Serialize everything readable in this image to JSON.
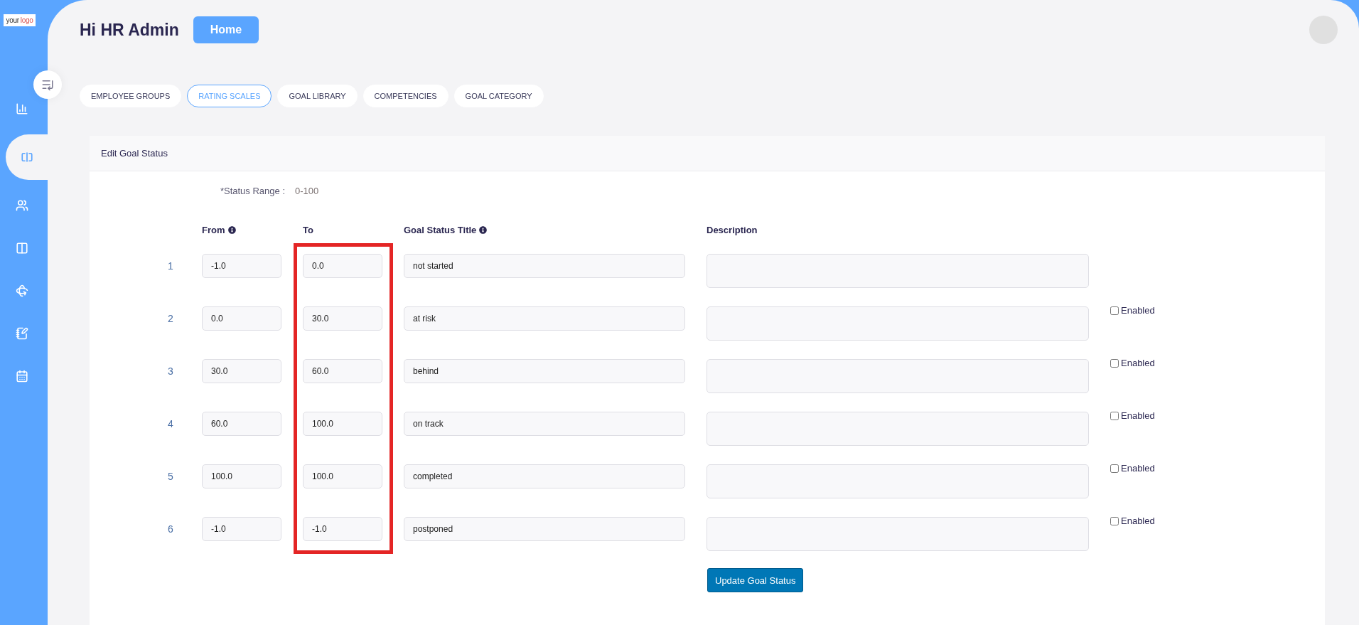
{
  "logo": {
    "first": "your",
    "second": "logo"
  },
  "sidebar": {
    "items": [
      {
        "kind": "chart",
        "selected": false
      },
      {
        "kind": "split",
        "selected": true
      },
      {
        "kind": "people",
        "selected": false
      },
      {
        "kind": "columns",
        "selected": false
      },
      {
        "kind": "rotate",
        "selected": false
      },
      {
        "kind": "notes",
        "selected": false
      },
      {
        "kind": "calendar",
        "selected": false
      }
    ]
  },
  "header": {
    "greeting": "Hi HR Admin",
    "home_button": "Home"
  },
  "tabs": [
    {
      "label": "EMPLOYEE GROUPS",
      "selected": false
    },
    {
      "label": "RATING SCALES",
      "selected": true
    },
    {
      "label": "GOAL LIBRARY",
      "selected": false
    },
    {
      "label": "COMPETENCIES",
      "selected": false
    },
    {
      "label": "GOAL CATEGORY",
      "selected": false
    }
  ],
  "card": {
    "title": "Edit Goal Status",
    "status_range_label": "*Status Range :",
    "status_range_value": "0-100",
    "columns": [
      {
        "label": "From",
        "info": true,
        "highlighted": false
      },
      {
        "label": "To",
        "info": false,
        "highlighted": true
      },
      {
        "label": "Goal Status Title",
        "info": true,
        "highlighted": false
      },
      {
        "label": "Description",
        "info": false,
        "highlighted": false
      }
    ],
    "rows": [
      {
        "number": "1",
        "from": "-1.0",
        "to": "0.0",
        "title": "not started"
      },
      {
        "number": "2",
        "from": "0.0",
        "to": "30.0",
        "title": "at risk",
        "enabled_label": "Enabled",
        "checked": false
      },
      {
        "number": "3",
        "from": "30.0",
        "to": "60.0",
        "title": "behind",
        "enabled_label": "Enabled",
        "checked": false
      },
      {
        "number": "4",
        "from": "60.0",
        "to": "100.0",
        "title": "on track",
        "enabled_label": "Enabled",
        "checked": false
      },
      {
        "number": "5",
        "from": "100.0",
        "to": "100.0",
        "title": "completed",
        "enabled_label": "Enabled",
        "checked": false
      },
      {
        "number": "6",
        "from": "-1.0",
        "to": "-1.0",
        "title": "postponed",
        "enabled_label": "Enabled",
        "checked": false
      }
    ],
    "submit_button": "Update Goal Status"
  }
}
